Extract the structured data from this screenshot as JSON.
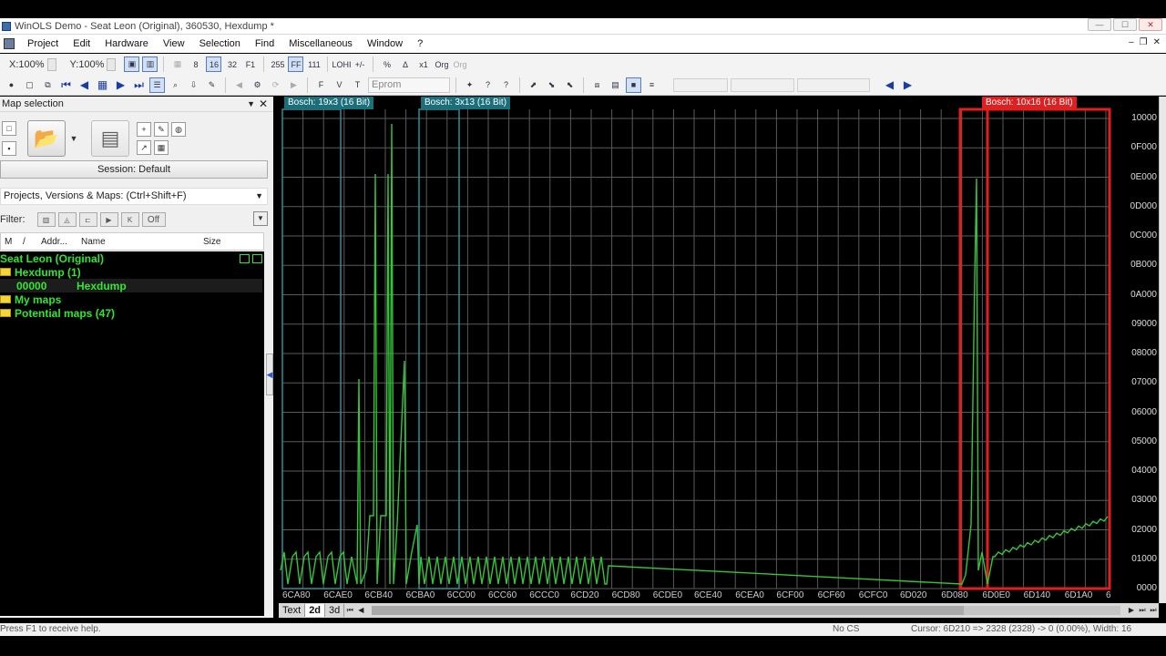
{
  "window": {
    "title": "WinOLS Demo - Seat Leon (Original), 360530, Hexdump *"
  },
  "menu": [
    "Project",
    "Edit",
    "Hardware",
    "View",
    "Selection",
    "Find",
    "Miscellaneous",
    "Window",
    "?"
  ],
  "toolbar": {
    "zoom_x": "X:100%",
    "zoom_y": "Y:100%",
    "format_buttons": [
      "8",
      "16",
      "32",
      "F1",
      "255",
      "FF",
      "111",
      "LOHI",
      "+/-",
      "%",
      "Δ",
      "x1",
      "Org",
      "Org"
    ],
    "eprom": "Eprom"
  },
  "sidebar": {
    "title": "Map selection",
    "session": "Session: Default",
    "projects_selector": "Projects, Versions & Maps:  (Ctrl+Shift+F)",
    "filter_label": "Filter:",
    "filter_off": "Off",
    "columns": [
      "M",
      "/",
      "Addr...",
      "Name",
      "Size"
    ],
    "tree": [
      {
        "label": "Seat Leon (Original)",
        "indent": 0,
        "folder": false
      },
      {
        "label": "Hexdump (1)",
        "indent": 0,
        "folder": true
      },
      {
        "label": "00000",
        "label2": "Hexdump",
        "indent": 1,
        "folder": false,
        "selected": true
      },
      {
        "label": "My maps",
        "indent": 0,
        "folder": true
      },
      {
        "label": "Potential maps (47)",
        "indent": 0,
        "folder": true
      }
    ]
  },
  "graph": {
    "map_labels": [
      {
        "text": "Bosch: 19x3 (16 Bit)",
        "color": "#1a6f7a"
      },
      {
        "text": "Bosch: 3x13 (16 Bit)",
        "color": "#1a6f7a"
      },
      {
        "text": "Bosch: 10x16 (16 Bit)",
        "color": "#e02020"
      }
    ],
    "x_labels": [
      "6CA80",
      "6CAE0",
      "6CB40",
      "6CBA0",
      "6CC00",
      "6CC60",
      "6CCC0",
      "6CD20",
      "6CD80",
      "6CDE0",
      "6CE40",
      "6CEA0",
      "6CF00",
      "6CF60",
      "6CFC0",
      "6D020",
      "6D080",
      "6D0E0",
      "6D140",
      "6D1A0",
      "6"
    ],
    "y_labels": [
      "10000",
      "0F000",
      "0E000",
      "0D000",
      "0C000",
      "0B000",
      "0A000",
      "09000",
      "08000",
      "07000",
      "06000",
      "05000",
      "04000",
      "03000",
      "02000",
      "01000",
      "0000"
    ],
    "line_color": "#36c43a",
    "grid_color": "#5a5a5a"
  },
  "view_tabs": [
    "Text",
    "2d",
    "3d"
  ],
  "status": {
    "help": "Press F1 to receive help.",
    "checksum": "No CS",
    "cursor": "Cursor: 6D210 => 2328 (2328) ->     0 (0.00%), Width: 16"
  }
}
